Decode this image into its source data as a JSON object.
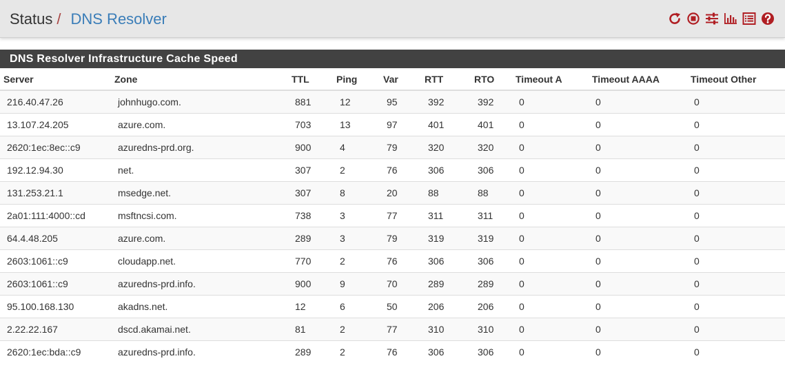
{
  "breadcrumb": {
    "root": "Status",
    "separator": "/",
    "current": "DNS Resolver"
  },
  "toolbar": {
    "icons": [
      "reload-icon",
      "stop-icon",
      "settings-sliders-icon",
      "chart-icon",
      "log-list-icon",
      "help-icon"
    ],
    "icon_color": "#b01e23"
  },
  "panel": {
    "title": "DNS Resolver Infrastructure Cache Speed"
  },
  "table": {
    "headers": {
      "server": "Server",
      "zone": "Zone",
      "ttl": "TTL",
      "ping": "Ping",
      "var": "Var",
      "rtt": "RTT",
      "rto": "RTO",
      "timeout_a": "Timeout A",
      "timeout_aaaa": "Timeout AAAA",
      "timeout_other": "Timeout Other"
    },
    "rows": [
      {
        "server": "216.40.47.26",
        "zone": "johnhugo.com.",
        "ttl": "881",
        "ping": "12",
        "var": "95",
        "rtt": "392",
        "rto": "392",
        "timeout_a": "0",
        "timeout_aaaa": "0",
        "timeout_other": "0"
      },
      {
        "server": "13.107.24.205",
        "zone": "azure.com.",
        "ttl": "703",
        "ping": "13",
        "var": "97",
        "rtt": "401",
        "rto": "401",
        "timeout_a": "0",
        "timeout_aaaa": "0",
        "timeout_other": "0"
      },
      {
        "server": "2620:1ec:8ec::c9",
        "zone": "azuredns-prd.org.",
        "ttl": "900",
        "ping": "4",
        "var": "79",
        "rtt": "320",
        "rto": "320",
        "timeout_a": "0",
        "timeout_aaaa": "0",
        "timeout_other": "0"
      },
      {
        "server": "192.12.94.30",
        "zone": "net.",
        "ttl": "307",
        "ping": "2",
        "var": "76",
        "rtt": "306",
        "rto": "306",
        "timeout_a": "0",
        "timeout_aaaa": "0",
        "timeout_other": "0"
      },
      {
        "server": "131.253.21.1",
        "zone": "msedge.net.",
        "ttl": "307",
        "ping": "8",
        "var": "20",
        "rtt": "88",
        "rto": "88",
        "timeout_a": "0",
        "timeout_aaaa": "0",
        "timeout_other": "0"
      },
      {
        "server": "2a01:111:4000::cd",
        "zone": "msftncsi.com.",
        "ttl": "738",
        "ping": "3",
        "var": "77",
        "rtt": "311",
        "rto": "311",
        "timeout_a": "0",
        "timeout_aaaa": "0",
        "timeout_other": "0"
      },
      {
        "server": "64.4.48.205",
        "zone": "azure.com.",
        "ttl": "289",
        "ping": "3",
        "var": "79",
        "rtt": "319",
        "rto": "319",
        "timeout_a": "0",
        "timeout_aaaa": "0",
        "timeout_other": "0"
      },
      {
        "server": "2603:1061::c9",
        "zone": "cloudapp.net.",
        "ttl": "770",
        "ping": "2",
        "var": "76",
        "rtt": "306",
        "rto": "306",
        "timeout_a": "0",
        "timeout_aaaa": "0",
        "timeout_other": "0"
      },
      {
        "server": "2603:1061::c9",
        "zone": "azuredns-prd.info.",
        "ttl": "900",
        "ping": "9",
        "var": "70",
        "rtt": "289",
        "rto": "289",
        "timeout_a": "0",
        "timeout_aaaa": "0",
        "timeout_other": "0"
      },
      {
        "server": "95.100.168.130",
        "zone": "akadns.net.",
        "ttl": "12",
        "ping": "6",
        "var": "50",
        "rtt": "206",
        "rto": "206",
        "timeout_a": "0",
        "timeout_aaaa": "0",
        "timeout_other": "0"
      },
      {
        "server": "2.22.22.167",
        "zone": "dscd.akamai.net.",
        "ttl": "81",
        "ping": "2",
        "var": "77",
        "rtt": "310",
        "rto": "310",
        "timeout_a": "0",
        "timeout_aaaa": "0",
        "timeout_other": "0"
      },
      {
        "server": "2620:1ec:bda::c9",
        "zone": "azuredns-prd.info.",
        "ttl": "289",
        "ping": "2",
        "var": "76",
        "rtt": "306",
        "rto": "306",
        "timeout_a": "0",
        "timeout_aaaa": "0",
        "timeout_other": "0"
      }
    ]
  }
}
